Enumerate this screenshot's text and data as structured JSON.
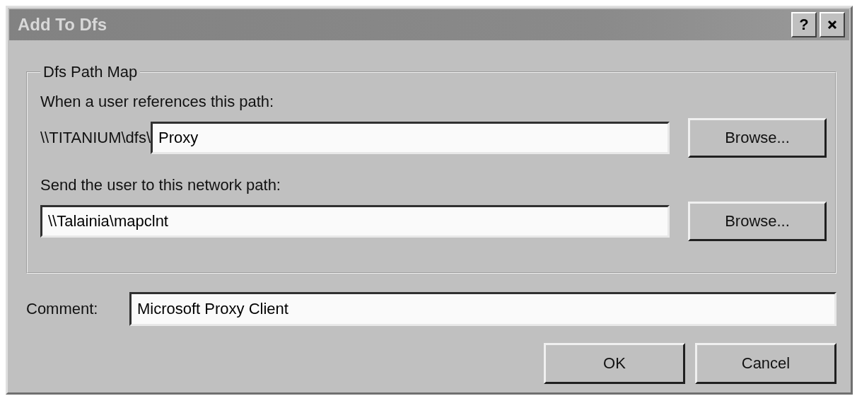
{
  "window": {
    "title": "Add To Dfs",
    "help_button": "?"
  },
  "group": {
    "title": "Dfs Path Map",
    "rows": [
      {
        "label": "When a user references this path:",
        "prefix": "\\\\TITANIUM\\dfs\\",
        "value": "Proxy",
        "button": "Browse..."
      },
      {
        "label": "Send the user to this network path:",
        "value": "\\\\Talainia\\mapclnt",
        "button": "Browse..."
      }
    ]
  },
  "comment": {
    "label": "Comment:",
    "value": "Microsoft Proxy Client"
  },
  "buttons": [
    "OK",
    "Cancel"
  ]
}
